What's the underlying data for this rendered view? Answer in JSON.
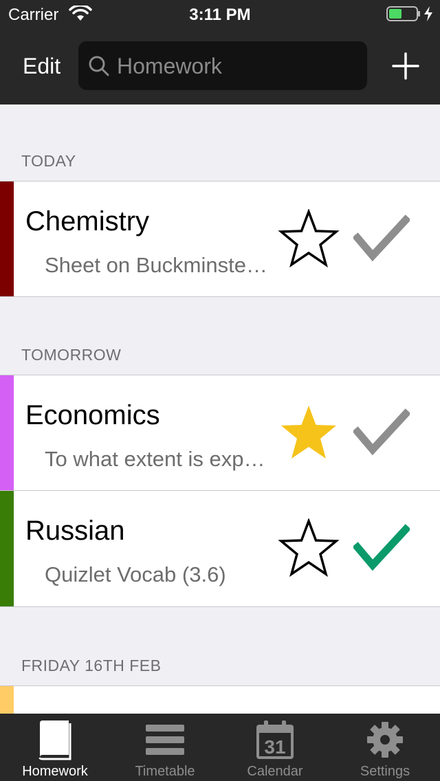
{
  "status_bar": {
    "carrier": "Carrier",
    "time": "3:11 PM",
    "battery_color": "#4cd964"
  },
  "nav": {
    "edit_label": "Edit",
    "search_placeholder": "Homework",
    "add_icon": "plus-icon"
  },
  "sections": [
    {
      "header": "TODAY",
      "items": [
        {
          "subject": "Chemistry",
          "description": "Sheet on Buckminsterfullerene",
          "color": "#7c0000",
          "starred": false,
          "completed": false
        }
      ]
    },
    {
      "header": "TOMORROW",
      "items": [
        {
          "subject": "Economics",
          "description": "To what extent is expansionary fiscal policy effective",
          "color": "#d460f5",
          "starred": true,
          "completed": false
        },
        {
          "subject": "Russian",
          "description": "Quizlet Vocab (3.6)",
          "color": "#3a7d06",
          "starred": false,
          "completed": true
        }
      ]
    },
    {
      "header": "FRIDAY 16TH FEB",
      "items": [
        {
          "color": "#ffcc66"
        }
      ]
    }
  ],
  "colors": {
    "star_filled": "#f5c31a",
    "check_done": "#0b9a6a",
    "check_pending": "#8e8e8e"
  },
  "tabs": [
    {
      "label": "Homework",
      "icon": "book-icon",
      "active": true
    },
    {
      "label": "Timetable",
      "icon": "list-icon",
      "active": false
    },
    {
      "label": "Calendar",
      "icon": "calendar-icon",
      "active": false,
      "badge": "31"
    },
    {
      "label": "Settings",
      "icon": "gear-icon",
      "active": false
    }
  ]
}
